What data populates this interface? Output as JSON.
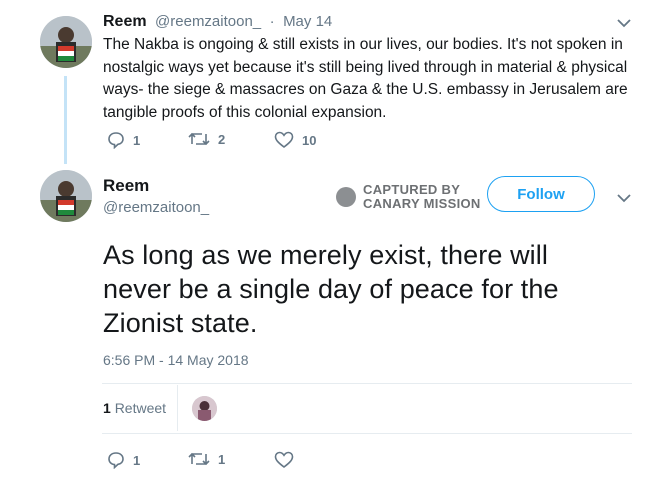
{
  "reply_tweet": {
    "name": "Reem",
    "handle": "@reemzaitoon_",
    "separator": "·",
    "date": "May 14",
    "text_lines": [
      "The Nakba is ongoing & still exists in our lives, our bodies. It's not spoken in",
      "nostalgic ways yet because it's still being lived through in material & physical",
      "ways- the siege & massacres on Gaza & the U.S. embassy in Jerusalem are",
      "tangible proofs of this colonial expansion."
    ],
    "replies": "1",
    "retweets": "2",
    "likes": "10"
  },
  "main_tweet": {
    "name": "Reem",
    "handle": "@reemzaitoon_",
    "follow_label": "Follow",
    "text_lines": [
      "As long as we merely exist, there will",
      "never be a single day of peace for the",
      "Zionist state."
    ],
    "timestamp": "6:56 PM - 14 May 2018",
    "retweet_count": "1",
    "retweet_label": "Retweet",
    "replies": "1",
    "retweets": "1"
  },
  "watermark": {
    "line1": "CAPTURED BY",
    "line2": "CANARY MISSION"
  },
  "colors": {
    "accent": "#1da1f2",
    "muted": "#657786",
    "thread_line": "#c4e3f7"
  }
}
